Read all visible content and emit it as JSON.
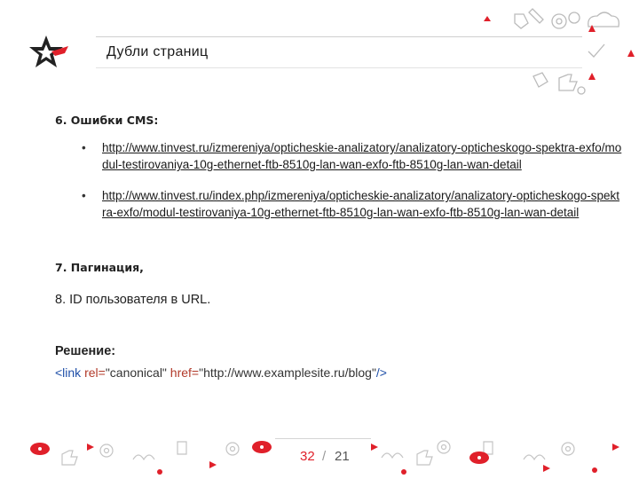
{
  "slide": {
    "title": "Дубли страниц",
    "brand_color": "#e0202a",
    "logo_icon": "star-logo-icon"
  },
  "content": {
    "cms_heading": "6. Ошибки CMS:",
    "links": [
      "http://www.tinvest.ru/izmereniya/opticheskie-analizatory/analizatory-opticheskogo-spektra-exfo/modul-testirovaniya-10g-ethernet-ftb-8510g-lan-wan-exfo-ftb-8510g-lan-wan-detail",
      "http://www.tinvest.ru/index.php/izmereniya/opticheskie-analizatory/analizatory-opticheskogo-spektra-exfo/modul-testirovaniya-10g-ethernet-ftb-8510g-lan-wan-exfo-ftb-8510g-lan-wan-detail"
    ],
    "pagination_heading": "7. Пагинация,",
    "item8": "8. ID пользователя в URL.",
    "solution_label": "Решение:",
    "code": {
      "open": "<link",
      "rel_attr": "rel=",
      "rel_val": "\"canonical\"",
      "href_attr": "href=",
      "href_val": "\"http://www.examplesite.ru/blog\"",
      "close": "/>"
    }
  },
  "pager": {
    "current": "32",
    "separator": "/",
    "total": "21"
  }
}
